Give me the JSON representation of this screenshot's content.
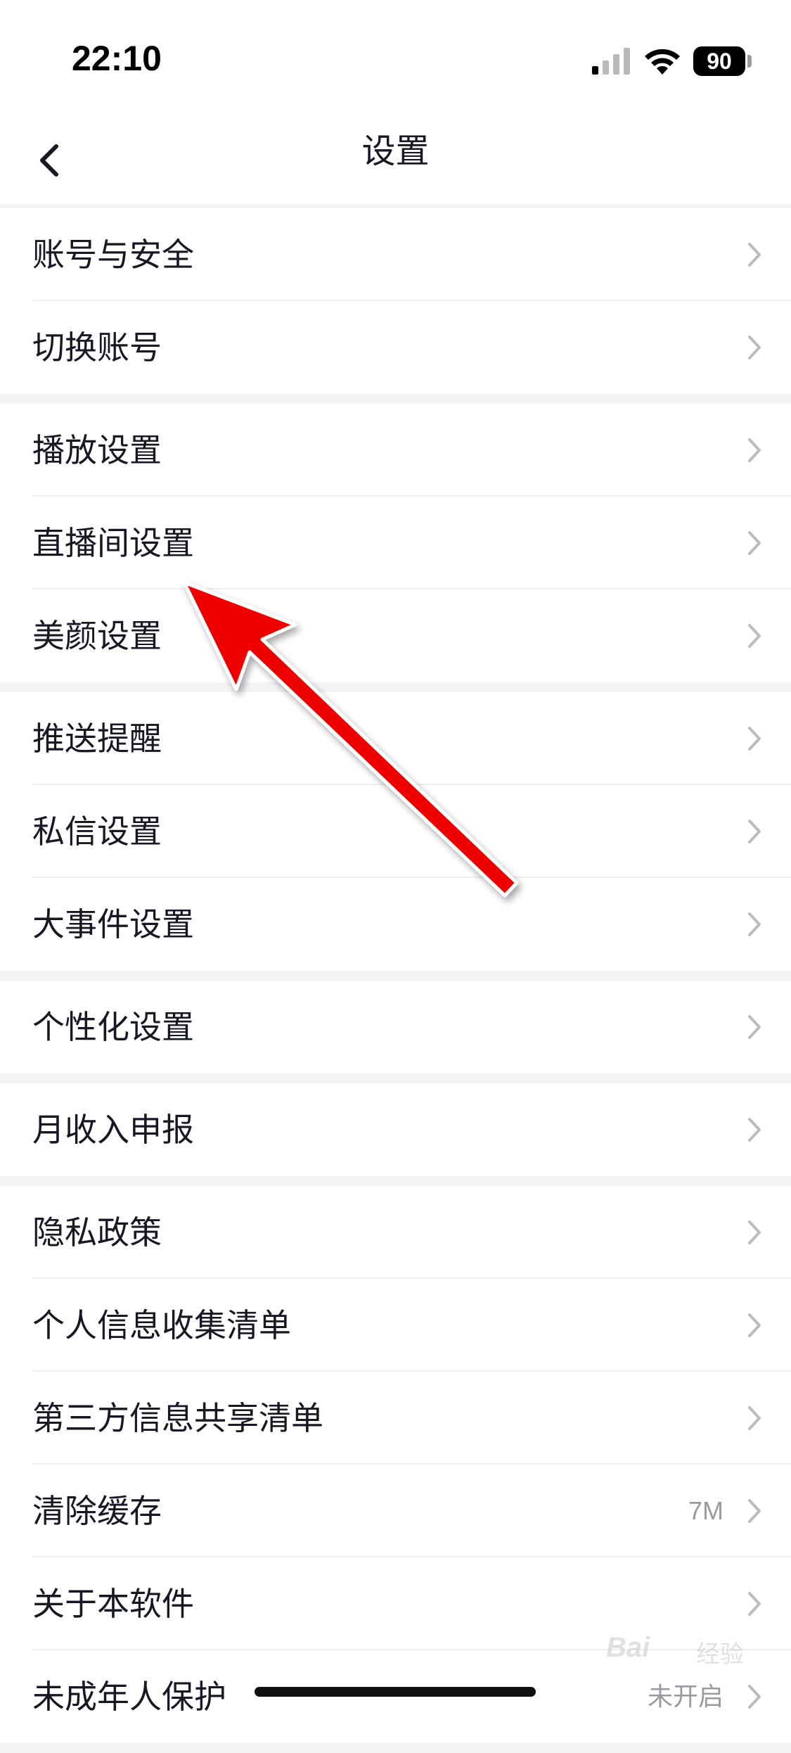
{
  "status_bar": {
    "time": "22:10",
    "battery": "90"
  },
  "nav": {
    "title": "设置"
  },
  "groups": [
    {
      "items": [
        {
          "label": "账号与安全"
        },
        {
          "label": "切换账号"
        }
      ]
    },
    {
      "items": [
        {
          "label": "播放设置"
        },
        {
          "label": "直播间设置"
        },
        {
          "label": "美颜设置"
        }
      ]
    },
    {
      "items": [
        {
          "label": "推送提醒"
        },
        {
          "label": "私信设置"
        },
        {
          "label": "大事件设置"
        }
      ]
    },
    {
      "items": [
        {
          "label": "个性化设置"
        }
      ]
    },
    {
      "items": [
        {
          "label": "月收入申报"
        }
      ]
    },
    {
      "items": [
        {
          "label": "隐私政策"
        },
        {
          "label": "个人信息收集清单"
        },
        {
          "label": "第三方信息共享清单"
        },
        {
          "label": "清除缓存",
          "value": "7M"
        },
        {
          "label": "关于本软件"
        },
        {
          "label": "未成年人保护",
          "value": "未开启"
        }
      ]
    }
  ],
  "watermark": {
    "brand": "Bai",
    "sub": "经验"
  },
  "colors": {
    "arrow": "#ee0000",
    "text": "#161823",
    "muted": "#9a9ba0"
  },
  "icons": [
    "back-arrow-icon",
    "signal-icon",
    "wifi-icon",
    "battery-icon",
    "chevron-right-icon",
    "annotation-arrow-icon"
  ]
}
